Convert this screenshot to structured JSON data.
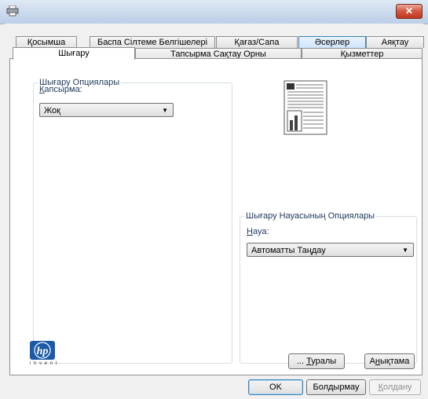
{
  "window": {
    "close_glyph": "✕",
    "icon": "printer-icon"
  },
  "tabs_row1": [
    "Қосымша",
    "Баспа Сілтеме Белгішелері",
    "Қағаз/Сапа",
    "Әсерлер",
    "Аяқтау"
  ],
  "tabs_row2": [
    "Шығару",
    "Тапсырма Сақтау Орны",
    "Қызметтер"
  ],
  "selected_tab": "Шығару",
  "output_options": {
    "group_title": "Шығару Опциялары",
    "stapling_label_prefix": "",
    "stapling_label_mnemonic": "Қ",
    "stapling_label_rest": "апсырма:",
    "stapling_value": "Жоқ"
  },
  "output_bin_options": {
    "group_title": "Шығару Науасының Опциялары",
    "bin_label_mnemonic": "Н",
    "bin_label_rest": "ауа:",
    "bin_value": "Автоматты Таңдау"
  },
  "hp_logo": {
    "brand": "hp",
    "tagline": "i n v e n t"
  },
  "buttons": {
    "about_prefix": "... ",
    "about_mnemonic": "Т",
    "about_rest": "уралы",
    "help_prefix": "А",
    "help_mnemonic": "н",
    "help_rest": "ықтама",
    "ok": "OK",
    "cancel": "Болдырмау",
    "apply_mnemonic": "Қ",
    "apply_rest": "олдану"
  },
  "colors": {
    "label_blue": "#1e395b",
    "hp_blue": "#1c5aa6",
    "close_red": "#c0391d"
  }
}
